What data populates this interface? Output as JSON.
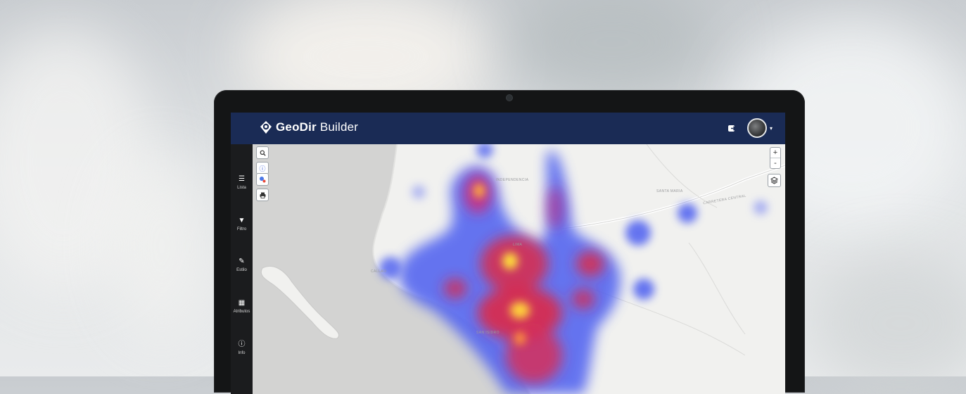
{
  "app": {
    "brand_bold": "GeoDir",
    "brand_light": " Builder"
  },
  "header": {
    "actions": [
      {
        "icon": "share-out-icon"
      },
      {
        "icon": "user-avatar"
      }
    ]
  },
  "sidebar": {
    "items": [
      {
        "label": "Lista",
        "icon": "list-icon"
      },
      {
        "label": "Filtro",
        "icon": "filter-icon"
      },
      {
        "label": "Estilo",
        "icon": "edit-icon"
      },
      {
        "label": "Atributos",
        "icon": "table-icon"
      },
      {
        "label": "Info",
        "icon": "info-icon"
      }
    ]
  },
  "map": {
    "tools": [
      "search-icon",
      "info-icon",
      "locate-icon",
      "print-icon"
    ],
    "zoom_in": "+",
    "zoom_out": "-",
    "labels": [
      "INDEPENDENCIA",
      "SANTA MARIA",
      "CARRETERA CENTRAL",
      "LIMA",
      "SAN ISIDRO",
      "CALLAO"
    ]
  },
  "colors": {
    "header": "#1a2b55",
    "sidebar": "#1b1c1e",
    "heat_low": "#4b5cf0",
    "heat_mid": "#e0283c",
    "heat_high": "#ffd23a"
  }
}
